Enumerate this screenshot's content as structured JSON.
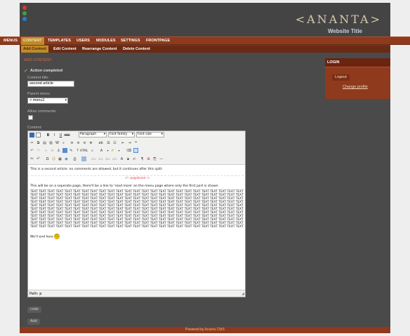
{
  "header": {
    "logo_text": "ANANTA",
    "site_title": "Website Title",
    "dot_colors": [
      "#d04020",
      "#40a040",
      "#2080d0"
    ]
  },
  "menu": {
    "items": [
      {
        "label": "MENUS"
      },
      {
        "label": "CONTENT"
      },
      {
        "label": "TEMPLATES"
      },
      {
        "label": "USERS"
      },
      {
        "label": "MODULES"
      },
      {
        "label": "SETTINGS"
      },
      {
        "label": "FRONTPAGE"
      }
    ],
    "active": "CONTENT"
  },
  "submenu": {
    "items": [
      {
        "label": "Add Content"
      },
      {
        "label": "Edit Content"
      },
      {
        "label": "Rearrange Content"
      },
      {
        "label": "Delete Content"
      }
    ],
    "active": "Add Content"
  },
  "main": {
    "section_title": "ADD CONTENT",
    "action_message": "Action completed",
    "content_title_label": "Content title:",
    "content_title_value": "second article",
    "parent_menu_label": "Parent menu:",
    "parent_menu_value": "> menu1",
    "allow_comments_label": "Allow comments:",
    "content_label": "Content:",
    "code_button": "code",
    "add_button": "Add"
  },
  "editor": {
    "format_select": "Paragraph",
    "font_family_select": "Font family",
    "font_size_select": "Font size",
    "line1": "This is a second article: no comments are allowed, but it continues after this split:",
    "pagebreak": "<!--pagebreak-->",
    "line2": "This will be on a seperate page, there'll be a link to 'read more' on the menu page where only the first part is shown",
    "text_row": "TEXT TEXT TEXT TEXT TEXT TEXT TEXT TEXT TEXT TEXT TEXT TEXT TEXT TEXT TEXT TEXT TEXT TEXT TEXT TEXT TEXT TEXT TEXT TEXT TEXT",
    "closing": "We'll end here",
    "path": "Path: p"
  },
  "login": {
    "title": "LOGIN",
    "logout": "Logout",
    "change_profile": "Change profile"
  },
  "footer": {
    "powered_by": "Powered by",
    "cms_name": "Ananta CMS"
  }
}
